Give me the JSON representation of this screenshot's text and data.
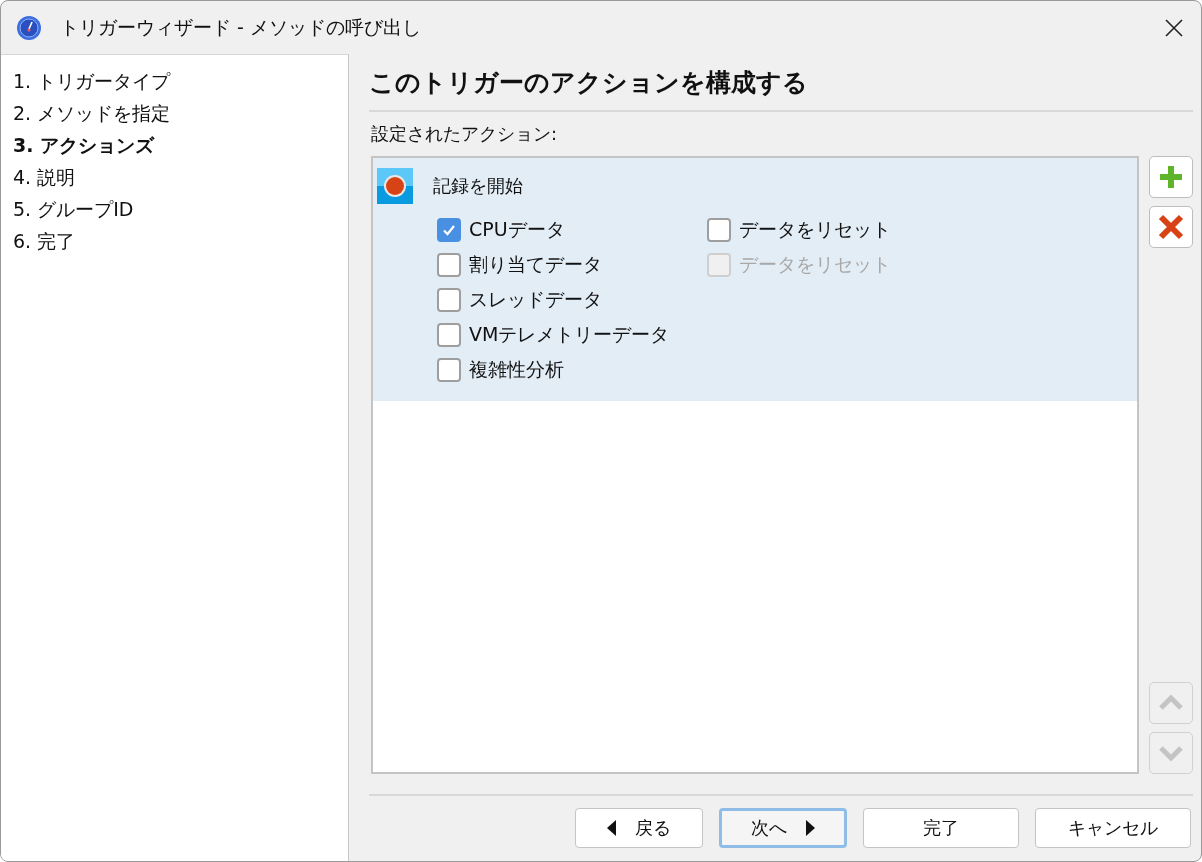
{
  "window": {
    "title": "トリガーウィザード - メソッドの呼び出し"
  },
  "steps": [
    {
      "label": "1. トリガータイプ",
      "selected": false
    },
    {
      "label": "2. メソッドを指定",
      "selected": false
    },
    {
      "label": "3. アクションズ",
      "selected": true
    },
    {
      "label": "4. 説明",
      "selected": false
    },
    {
      "label": "5. グループID",
      "selected": false
    },
    {
      "label": "6. 完了",
      "selected": false
    }
  ],
  "heading": "このトリガーのアクションを構成する",
  "actions_label": "設定されたアクション:",
  "actions": [
    {
      "label": "記録を開始",
      "selected": true,
      "columns": [
        [
          {
            "label": "CPUデータ",
            "checked": true,
            "disabled": false
          },
          {
            "label": "割り当てデータ",
            "checked": false,
            "disabled": false
          },
          {
            "label": "スレッドデータ",
            "checked": false,
            "disabled": false
          },
          {
            "label": "VMテレメトリーデータ",
            "checked": false,
            "disabled": false
          },
          {
            "label": "複雑性分析",
            "checked": false,
            "disabled": false
          }
        ],
        [
          {
            "label": "データをリセット",
            "checked": false,
            "disabled": false
          },
          {
            "label": "データをリセット",
            "checked": false,
            "disabled": true
          }
        ]
      ]
    }
  ],
  "side_buttons": [
    {
      "kind": "add",
      "disabled": false
    },
    {
      "kind": "remove",
      "disabled": false
    },
    {
      "kind": "up",
      "disabled": true
    },
    {
      "kind": "down",
      "disabled": true
    }
  ],
  "buttons": [
    {
      "label": "戻る",
      "kind": "back",
      "default": false
    },
    {
      "label": "次へ",
      "kind": "next",
      "default": true
    },
    {
      "label": "完了",
      "kind": "plain",
      "default": false
    },
    {
      "label": "キャンセル",
      "kind": "plain",
      "default": false
    }
  ]
}
